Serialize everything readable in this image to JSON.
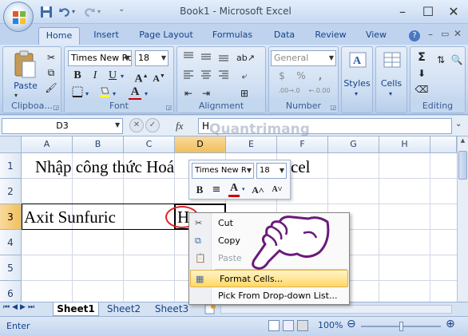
{
  "window": {
    "title": "Book1 - Microsoft Excel"
  },
  "tabs": [
    "Home",
    "Insert",
    "Page Layout",
    "Formulas",
    "Data",
    "Review",
    "View"
  ],
  "ribbon": {
    "clipboard": {
      "paste_label": "Paste",
      "group_label": "Clipboa..."
    },
    "font": {
      "font_name": "Times New Ro",
      "font_size": "18",
      "group_label": "Font",
      "bold": "B",
      "italic": "I",
      "underline": "U",
      "font_color": "#cc0000"
    },
    "alignment": {
      "group_label": "Alignment"
    },
    "number": {
      "format": "General",
      "currency": "$",
      "percent": "%",
      "comma": ",",
      "inc_decimal": ".00→.0",
      "dec_decimal": "←.0.00",
      "group_label": "Number"
    },
    "styles": {
      "label": "Styles"
    },
    "cells": {
      "label": "Cells"
    },
    "editing": {
      "sum": "Σ",
      "group_label": "Editing"
    }
  },
  "formula_bar": {
    "name_box": "D3",
    "fx": "fx",
    "value": "H"
  },
  "watermark": "Quantrimang",
  "columns": [
    "A",
    "B",
    "C",
    "D",
    "E",
    "F",
    "G",
    "H"
  ],
  "rows": [
    "1",
    "2",
    "3",
    "4",
    "5",
    "6"
  ],
  "cells": {
    "B1": "Nhập công thức Hoá",
    "E1": "cel",
    "A3": "Axit Sunfuric",
    "D3": "H"
  },
  "mini_toolbar": {
    "font_name": "Times New R",
    "font_size": "18",
    "bold": "B",
    "align": "≡",
    "font_color_glyph": "A",
    "grow": "A˄",
    "shrink": "A˅"
  },
  "context_menu": [
    {
      "label": "Cut",
      "enabled": true
    },
    {
      "label": "Copy",
      "enabled": true
    },
    {
      "label": "Paste",
      "enabled": false
    },
    {
      "label": "Format Cells...",
      "enabled": true,
      "highlighted": true
    },
    {
      "label": "Pick From Drop-down List...",
      "enabled": true
    }
  ],
  "sheets": [
    "Sheet1",
    "Sheet2",
    "Sheet3"
  ],
  "status": {
    "mode": "Enter",
    "zoom": "100%"
  },
  "colors": {
    "accent": "#15428b",
    "highlight": "#ffd966",
    "error_circle": "#e02020"
  }
}
